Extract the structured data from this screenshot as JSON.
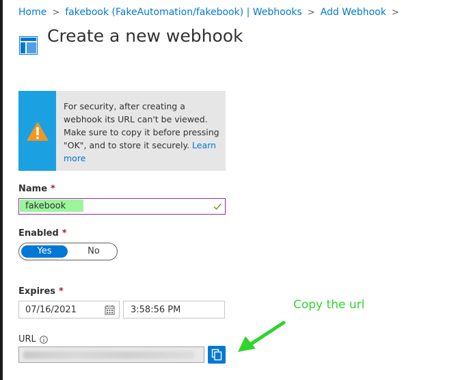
{
  "breadcrumb": {
    "items": [
      "Home",
      "fakebook (FakeAutomation/fakebook) | Webhooks",
      "Add Webhook"
    ],
    "separator": ">"
  },
  "page": {
    "title": "Create a new webhook",
    "icon": "blade-layout-icon"
  },
  "alert": {
    "icon": "warning-icon",
    "message": "For security, after creating a webhook its URL can't be viewed. Make sure to copy it before pressing \"OK\", and to store it securely.",
    "link": "Learn more"
  },
  "form": {
    "name": {
      "label": "Name",
      "required": "*",
      "value": "fakebook"
    },
    "enabled": {
      "label": "Enabled",
      "required": "*",
      "options": [
        "Yes",
        "No"
      ],
      "selected": "Yes"
    },
    "expires": {
      "label": "Expires",
      "required": "*",
      "date": "07/16/2021",
      "time": "3:58:56 PM"
    },
    "url": {
      "label": "URL",
      "value": ""
    }
  },
  "annotation": {
    "text": "Copy the url",
    "color": "#2fd42f"
  },
  "colors": {
    "accent": "#0078d4",
    "alert_bar": "#1ba1e2",
    "warning": "#f7941d",
    "required": "#a4262c",
    "highlight": "#9cf59c"
  }
}
